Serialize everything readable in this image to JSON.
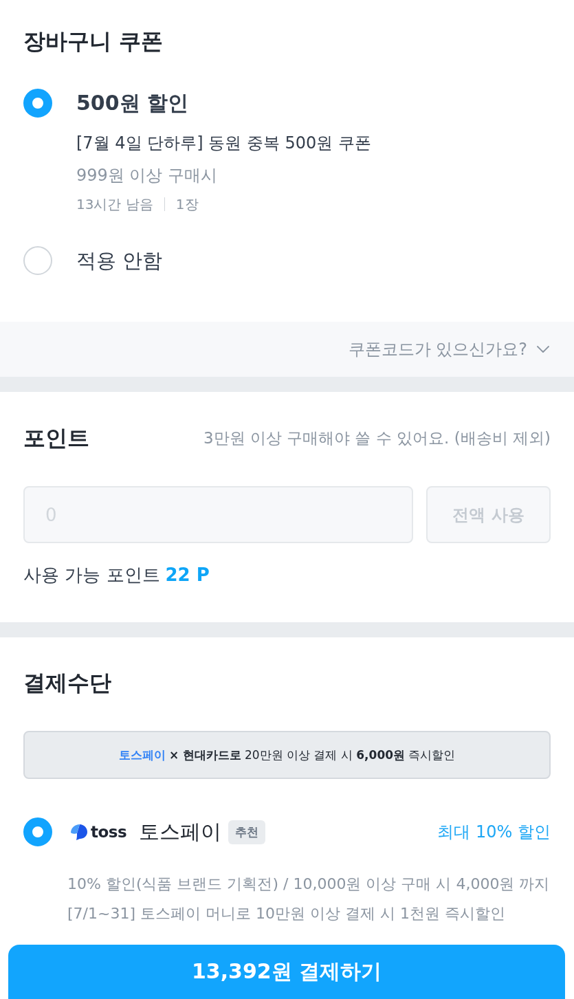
{
  "coupon": {
    "title": "장바구니 쿠폰",
    "options": [
      {
        "label": "500원 할인",
        "selected": true,
        "name": "[7월 4일 단하루] 동원 중복 500원 쿠폰",
        "condition": "999원 이상 구매시",
        "remaining": "13시간 남음",
        "count": "1장"
      },
      {
        "label": "적용 안함",
        "selected": false
      }
    ],
    "code_toggle": {
      "label": "쿠폰코드가 있으신가요?",
      "expanded": false
    }
  },
  "points": {
    "title": "포인트",
    "note": "3만원 이상 구매해야 쓸 수 있어요. (배송비 제외)",
    "input": {
      "placeholder": "0",
      "disabled": true
    },
    "use_all_button": {
      "label": "전액 사용",
      "disabled": true
    },
    "available_label": "사용 가능 포인트",
    "available_value": "22 P"
  },
  "payment": {
    "title": "결제수단",
    "banner": {
      "segments": [
        {
          "text": "토스페이",
          "kind": "brand"
        },
        {
          "text": "×",
          "kind": "bold"
        },
        {
          "text": "현대카드로",
          "kind": "bold"
        },
        {
          "text": "20만원 이상 결제 시",
          "kind": "plain"
        },
        {
          "text": "6,000원",
          "kind": "bold"
        },
        {
          "text": "즉시할인",
          "kind": "plain"
        }
      ]
    },
    "methods": [
      {
        "logo_text": "toss",
        "name": "토스페이",
        "badge": "추천",
        "benefit": "최대 10% 할인",
        "selected": true,
        "details": [
          "10% 할인(식품 브랜드 기획전) / 10,000원 이상 구매 시 4,000원 까지",
          "[7/1~31] 토스페이 머니로 10만원 이상 결제 시 1천원 즉시할인"
        ]
      }
    ]
  },
  "checkout_button": {
    "label": "13,392원 결제하기"
  }
}
